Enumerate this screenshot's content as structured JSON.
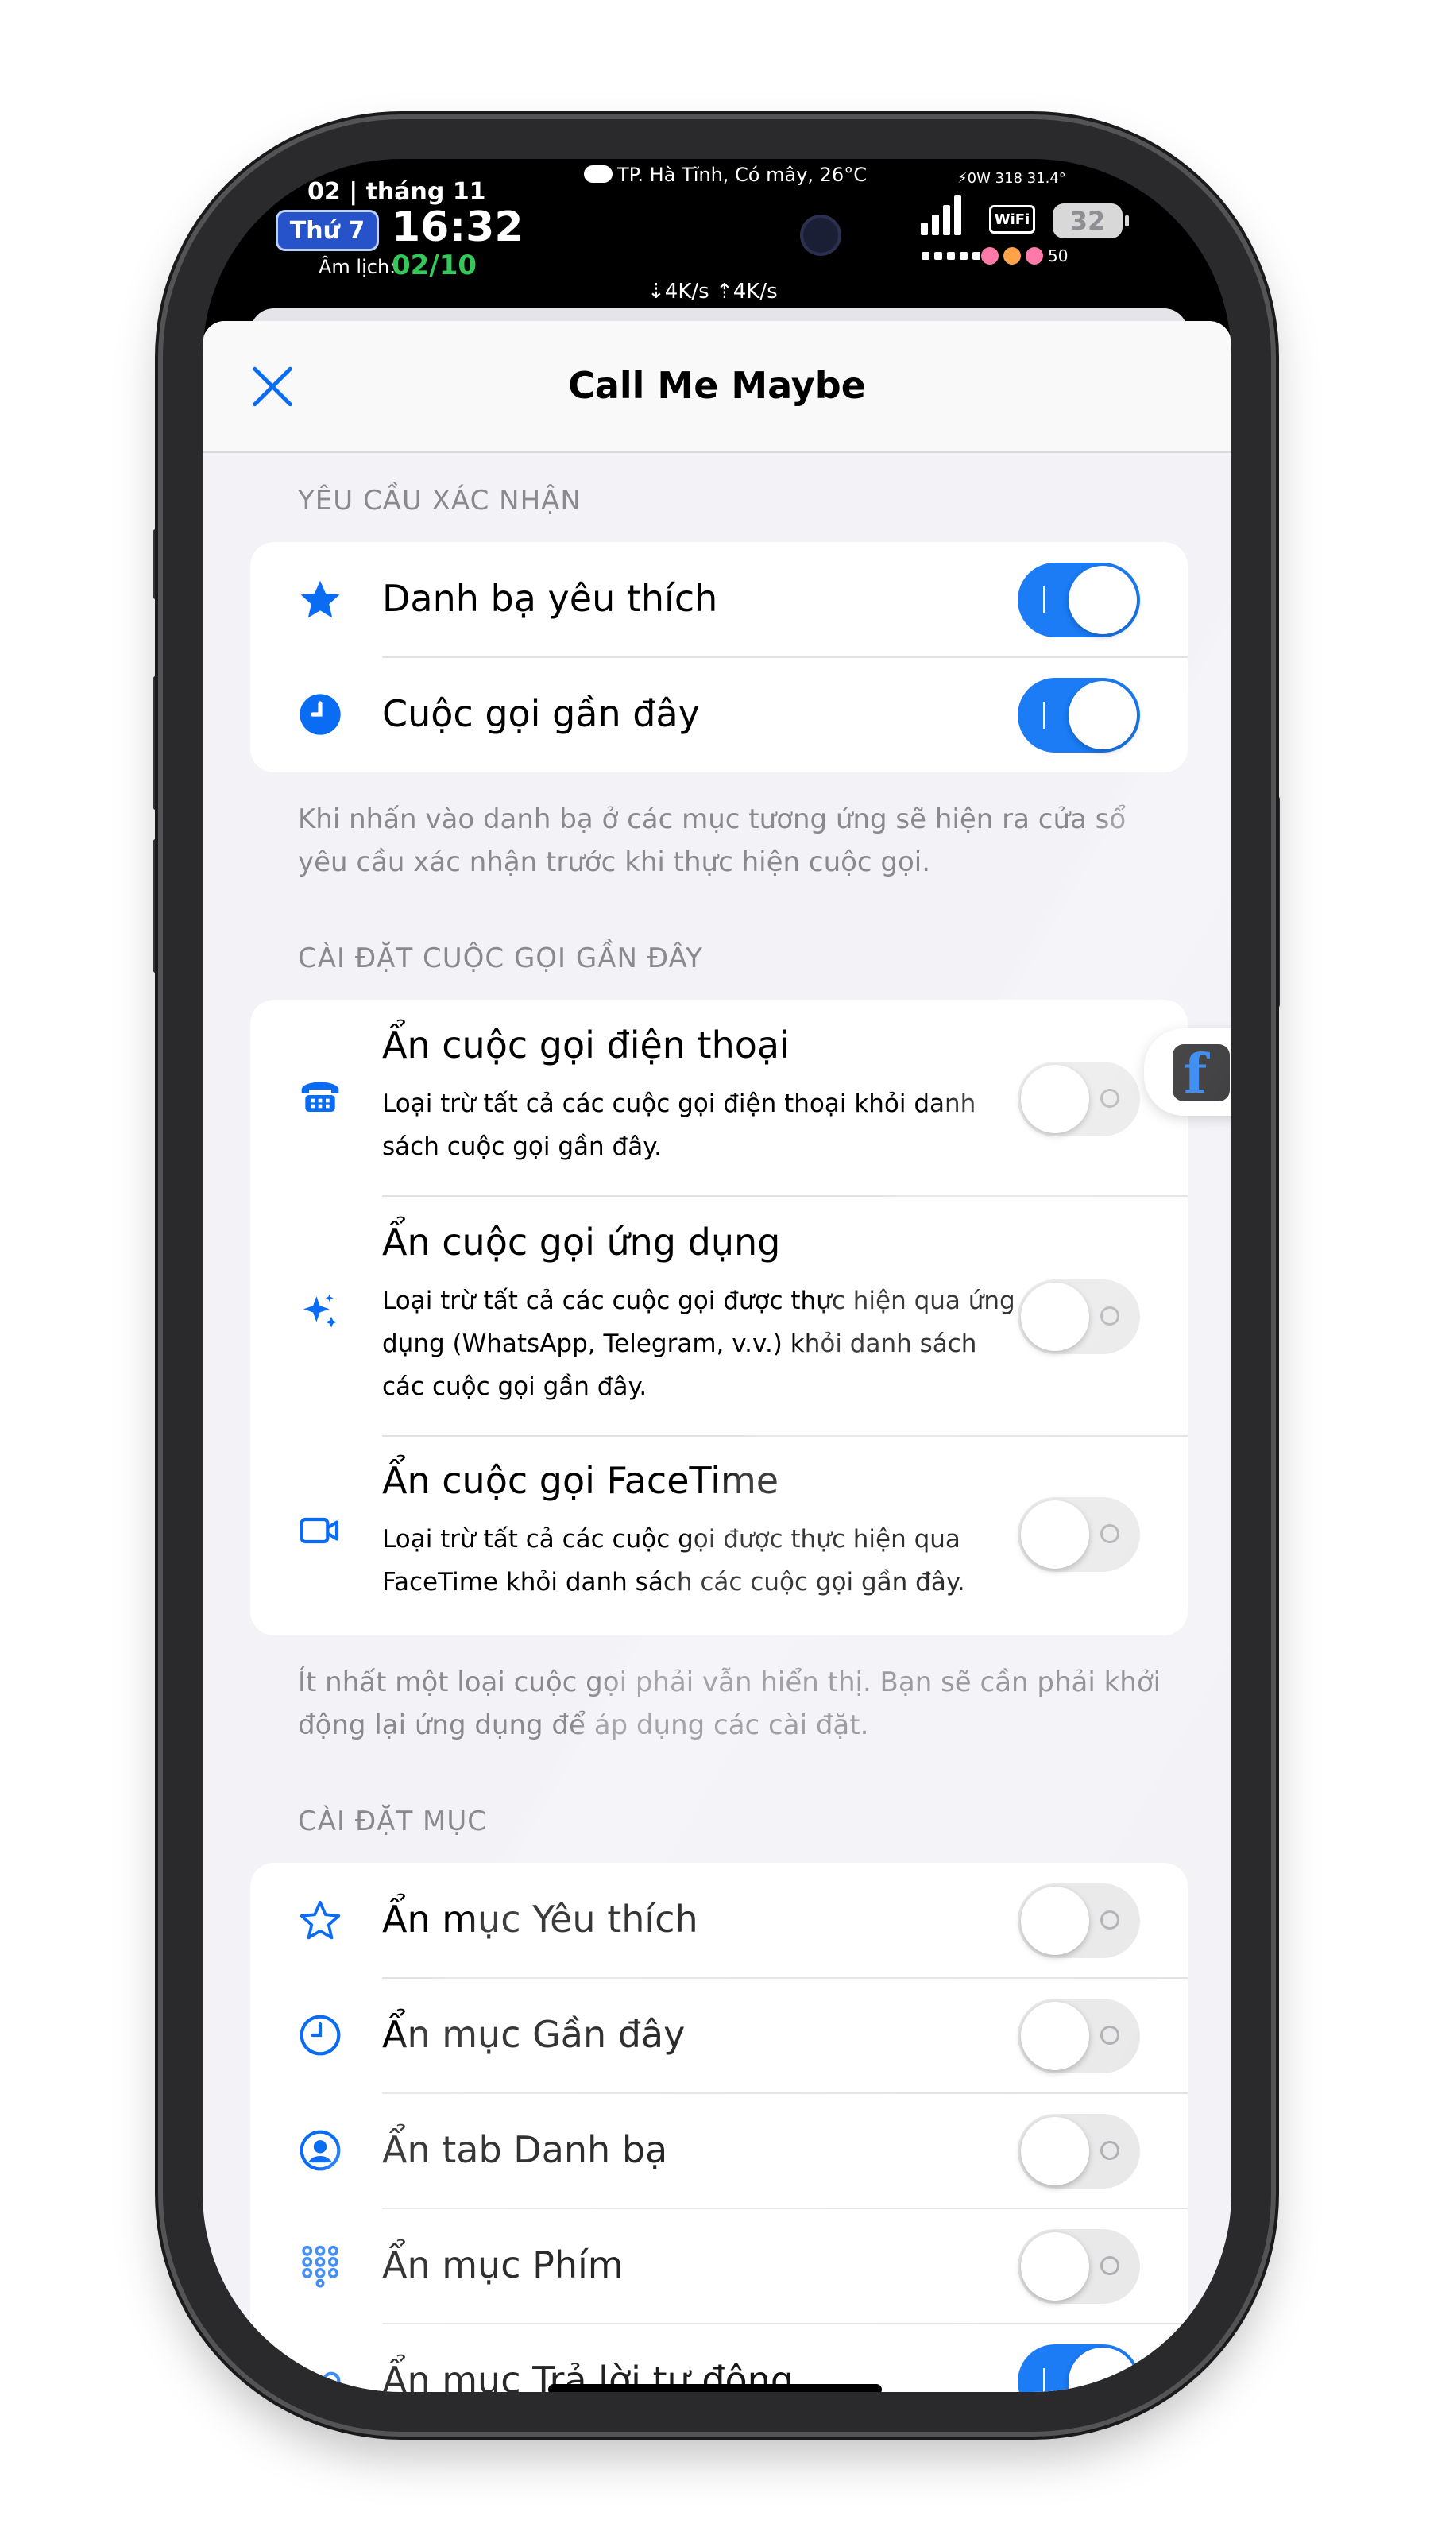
{
  "status_bar": {
    "date": "02 | tháng 11",
    "weekday": "Thứ 7",
    "time": "16:32",
    "lunar_label": "Âm lịch:",
    "lunar_date": "02/10",
    "weather": "TP. Hà Tĩnh, Có mây, 26°C",
    "net_speed": "⇣4K/s ⇡4K/s",
    "sys_info": "⚡0W  318  31.4°",
    "wifi": "WiFi",
    "battery": "32",
    "volume": "50"
  },
  "nav": {
    "title": "Call Me Maybe"
  },
  "confirm": {
    "header": "YÊU CẦU XÁC NHẬN",
    "items": [
      {
        "label": "Danh bạ yêu thích",
        "icon": "star-filled-icon",
        "enabled": true
      },
      {
        "label": "Cuộc gọi gần đây",
        "icon": "clock-filled-icon",
        "enabled": true
      }
    ],
    "note": "Khi nhấn vào danh bạ ở các mục tương ứng sẽ hiện ra cửa sổ yêu cầu xác nhận trước khi thực hiện cuộc gọi."
  },
  "recent": {
    "header": "CÀI ĐẶT CUỘC GỌI GẦN ĐÂY",
    "items": [
      {
        "label": "Ẩn cuộc gọi điện thoại",
        "sub": "Loại trừ tất cả các cuộc gọi điện thoại khỏi danh sách cuộc gọi gần đây.",
        "icon": "telephone-icon",
        "enabled": false
      },
      {
        "label": "Ẩn cuộc gọi ứng dụng",
        "sub": "Loại trừ tất cả các cuộc gọi được thực hiện qua ứng dụng (WhatsApp, Telegram, v.v.) khỏi danh sách các cuộc gọi gần đây.",
        "icon": "sparkles-icon",
        "enabled": false
      },
      {
        "label": "Ẩn cuộc gọi FaceTime",
        "sub": "Loại trừ tất cả các cuộc gọi được thực hiện qua FaceTime khỏi danh sách các cuộc gọi gần đây.",
        "icon": "video-camera-icon",
        "enabled": false
      }
    ],
    "note": "Ít nhất một loại cuộc gọi phải vẫn hiển thị. Bạn sẽ cần phải khởi động lại ứng dụng để áp dụng các cài đặt."
  },
  "items_settings": {
    "header": "CÀI ĐẶT MỤC",
    "items": [
      {
        "label": "Ẩn mục Yêu thích",
        "icon": "star-outline-icon",
        "enabled": false
      },
      {
        "label": "Ẩn mục Gần đây",
        "icon": "clock-outline-icon",
        "enabled": false
      },
      {
        "label": "Ẩn tab Danh bạ",
        "icon": "person-circle-icon",
        "enabled": false
      },
      {
        "label": "Ẩn mục Phím",
        "icon": "keypad-icon",
        "enabled": false
      },
      {
        "label": "Ẩn mục Trả lời tự động",
        "icon": "voicemail-icon",
        "enabled": true
      }
    ]
  },
  "colors": {
    "accent": "#0a6cf3",
    "toggle_on": "#1b7cf6",
    "background": "#f2f2f7"
  }
}
